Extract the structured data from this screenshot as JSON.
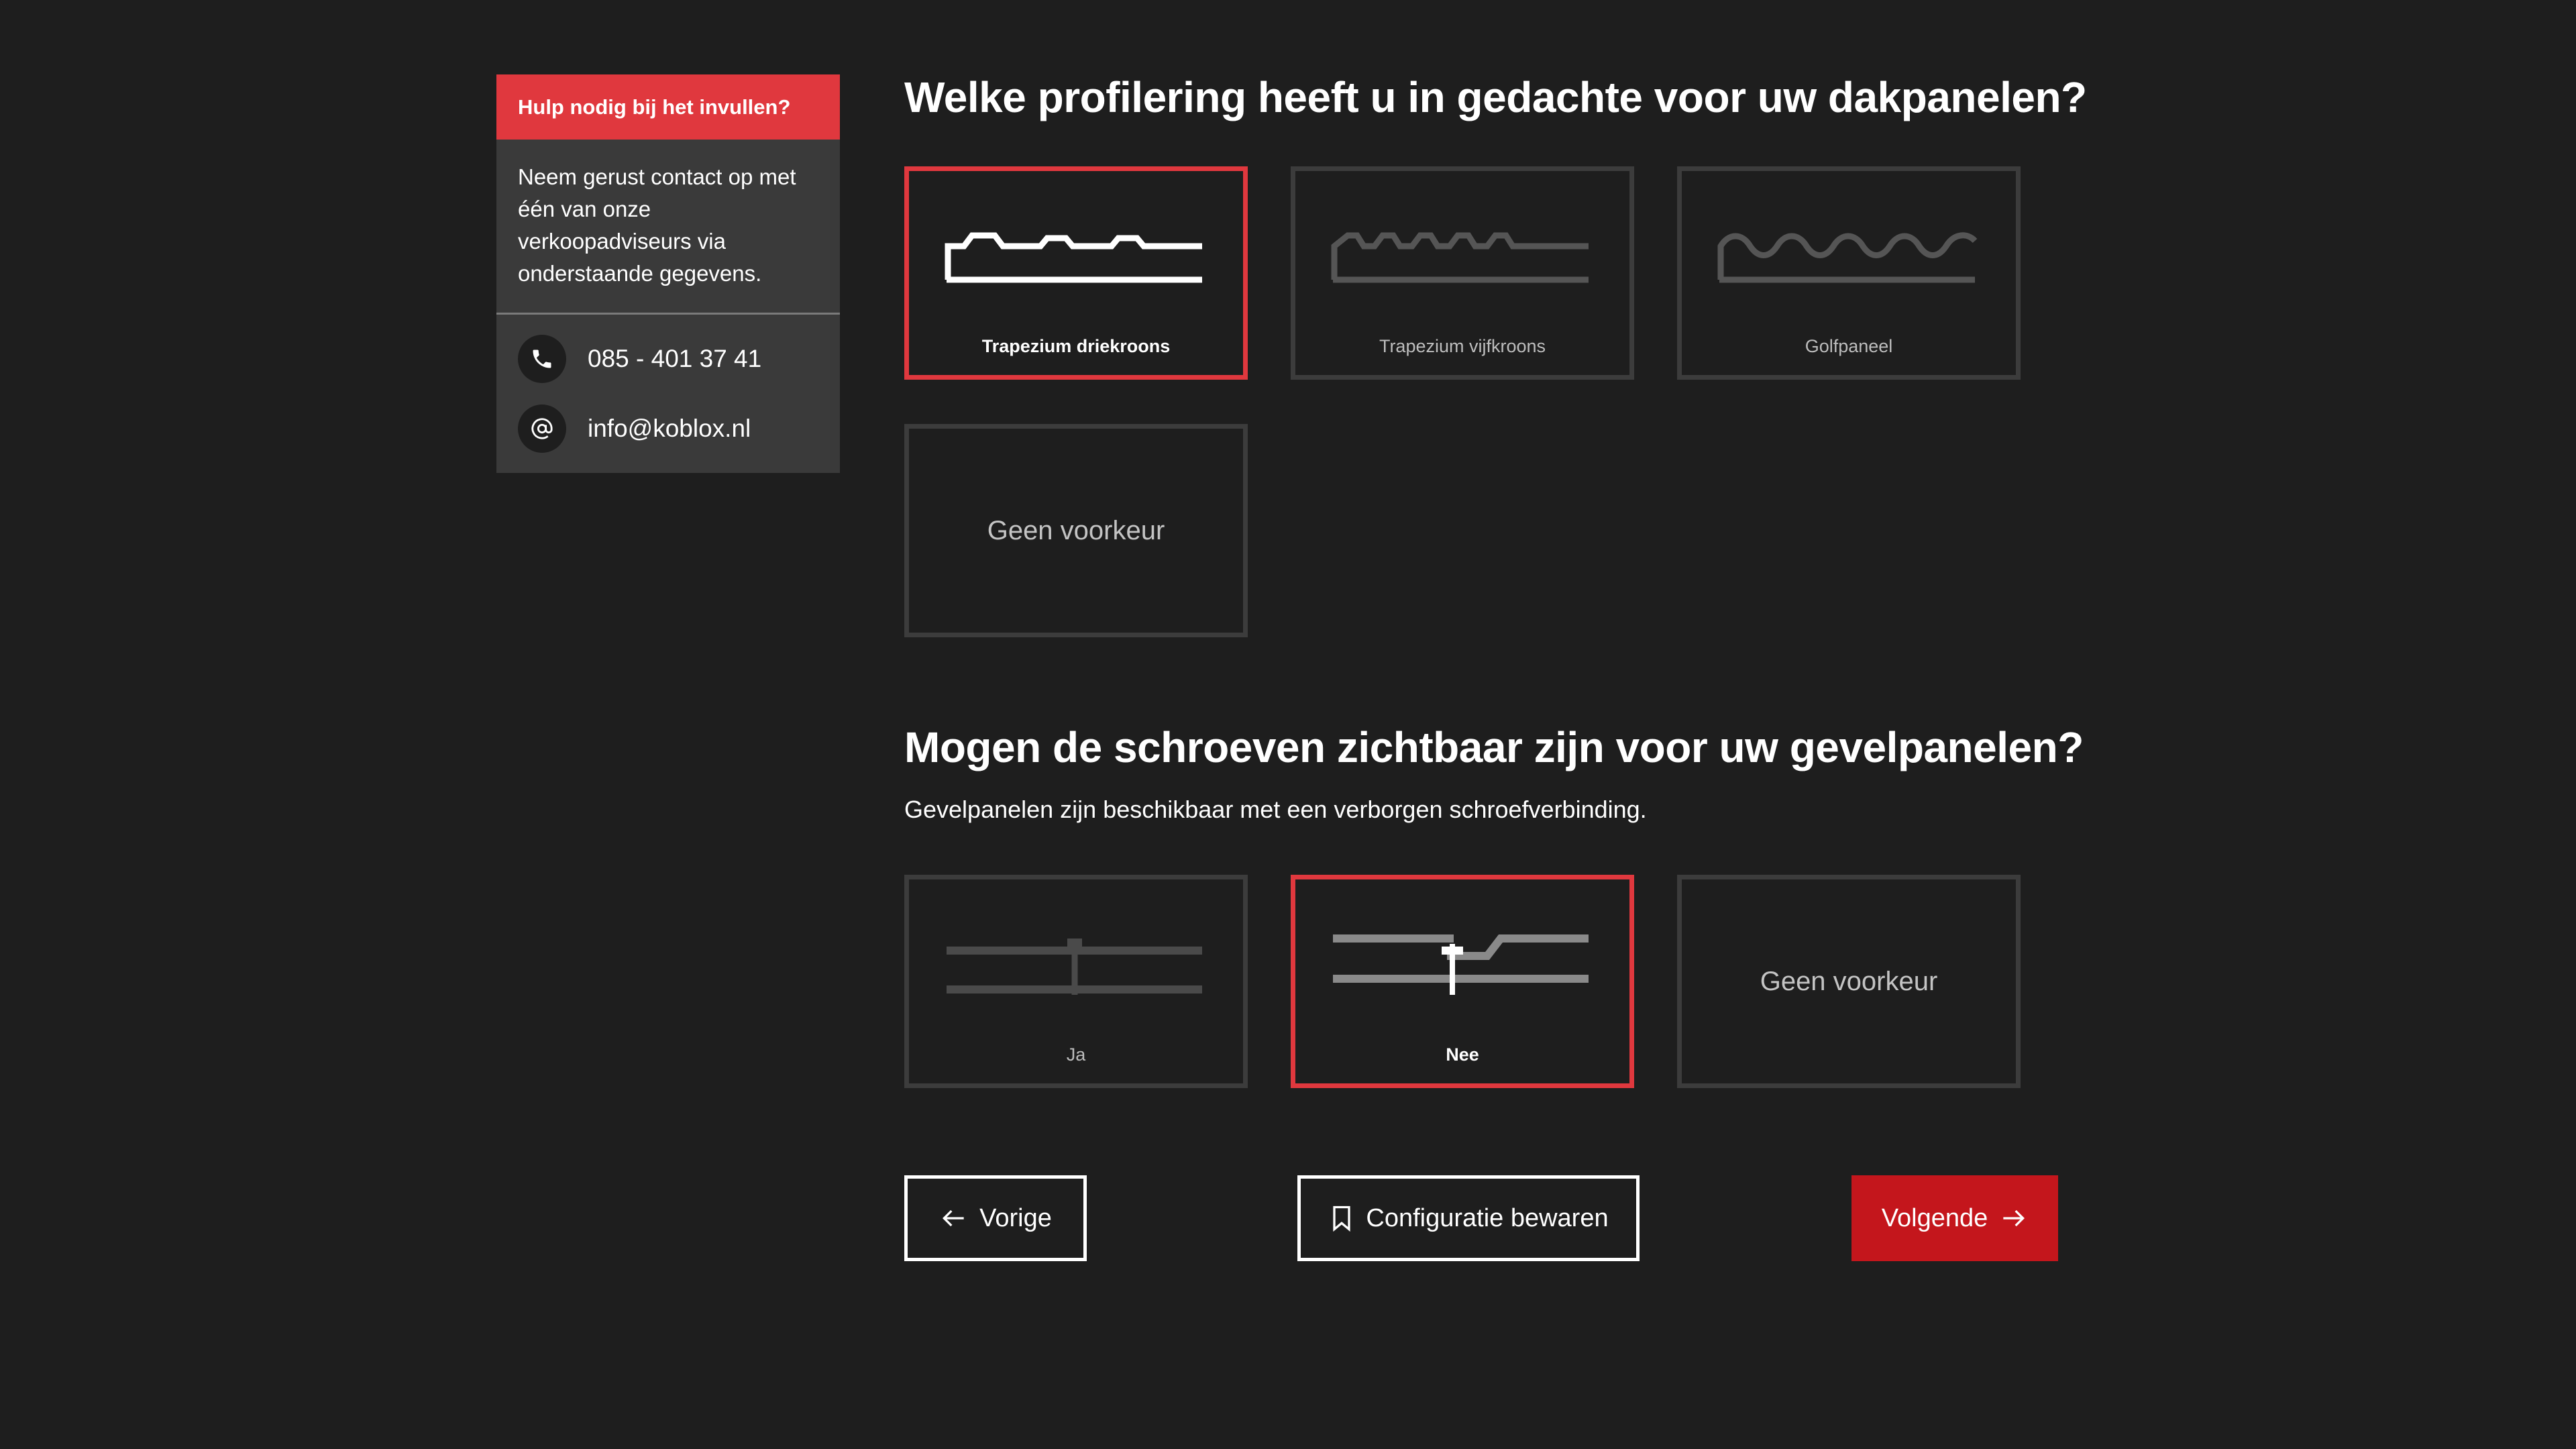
{
  "help": {
    "header": "Hulp nodig bij het invullen?",
    "body": "Neem gerust contact op met één van onze verkoopadviseurs via onderstaande gegevens.",
    "phone": "085 - 401 37 41",
    "email": "info@koblox.nl"
  },
  "q1": {
    "title": "Welke profilering heeft u in gedachte voor uw dakpanelen?",
    "options": [
      {
        "label": "Trapezium driekroons",
        "selected": true,
        "icon": "trapezium-3-profile-icon"
      },
      {
        "label": "Trapezium vijfkroons",
        "selected": false,
        "icon": "trapezium-5-profile-icon"
      },
      {
        "label": "Golfpaneel",
        "selected": false,
        "icon": "wave-profile-icon"
      },
      {
        "label": "Geen voorkeur",
        "selected": false
      }
    ]
  },
  "q2": {
    "title": "Mogen de schroeven zichtbaar zijn voor uw gevelpanelen?",
    "subtitle": "Gevelpanelen zijn beschikbaar met een verborgen schroefverbinding.",
    "options": [
      {
        "label": "Ja",
        "selected": false,
        "icon": "visible-screw-icon"
      },
      {
        "label": "Nee",
        "selected": true,
        "icon": "hidden-screw-icon"
      },
      {
        "label": "Geen voorkeur",
        "selected": false
      }
    ]
  },
  "nav": {
    "prev": "Vorige",
    "save": "Configuratie bewaren",
    "next": "Volgende"
  },
  "colors": {
    "background": "#1e1e1e",
    "accent": "#e0383e",
    "primary_button": "#c4161c",
    "card_border": "#3c3c3c"
  }
}
